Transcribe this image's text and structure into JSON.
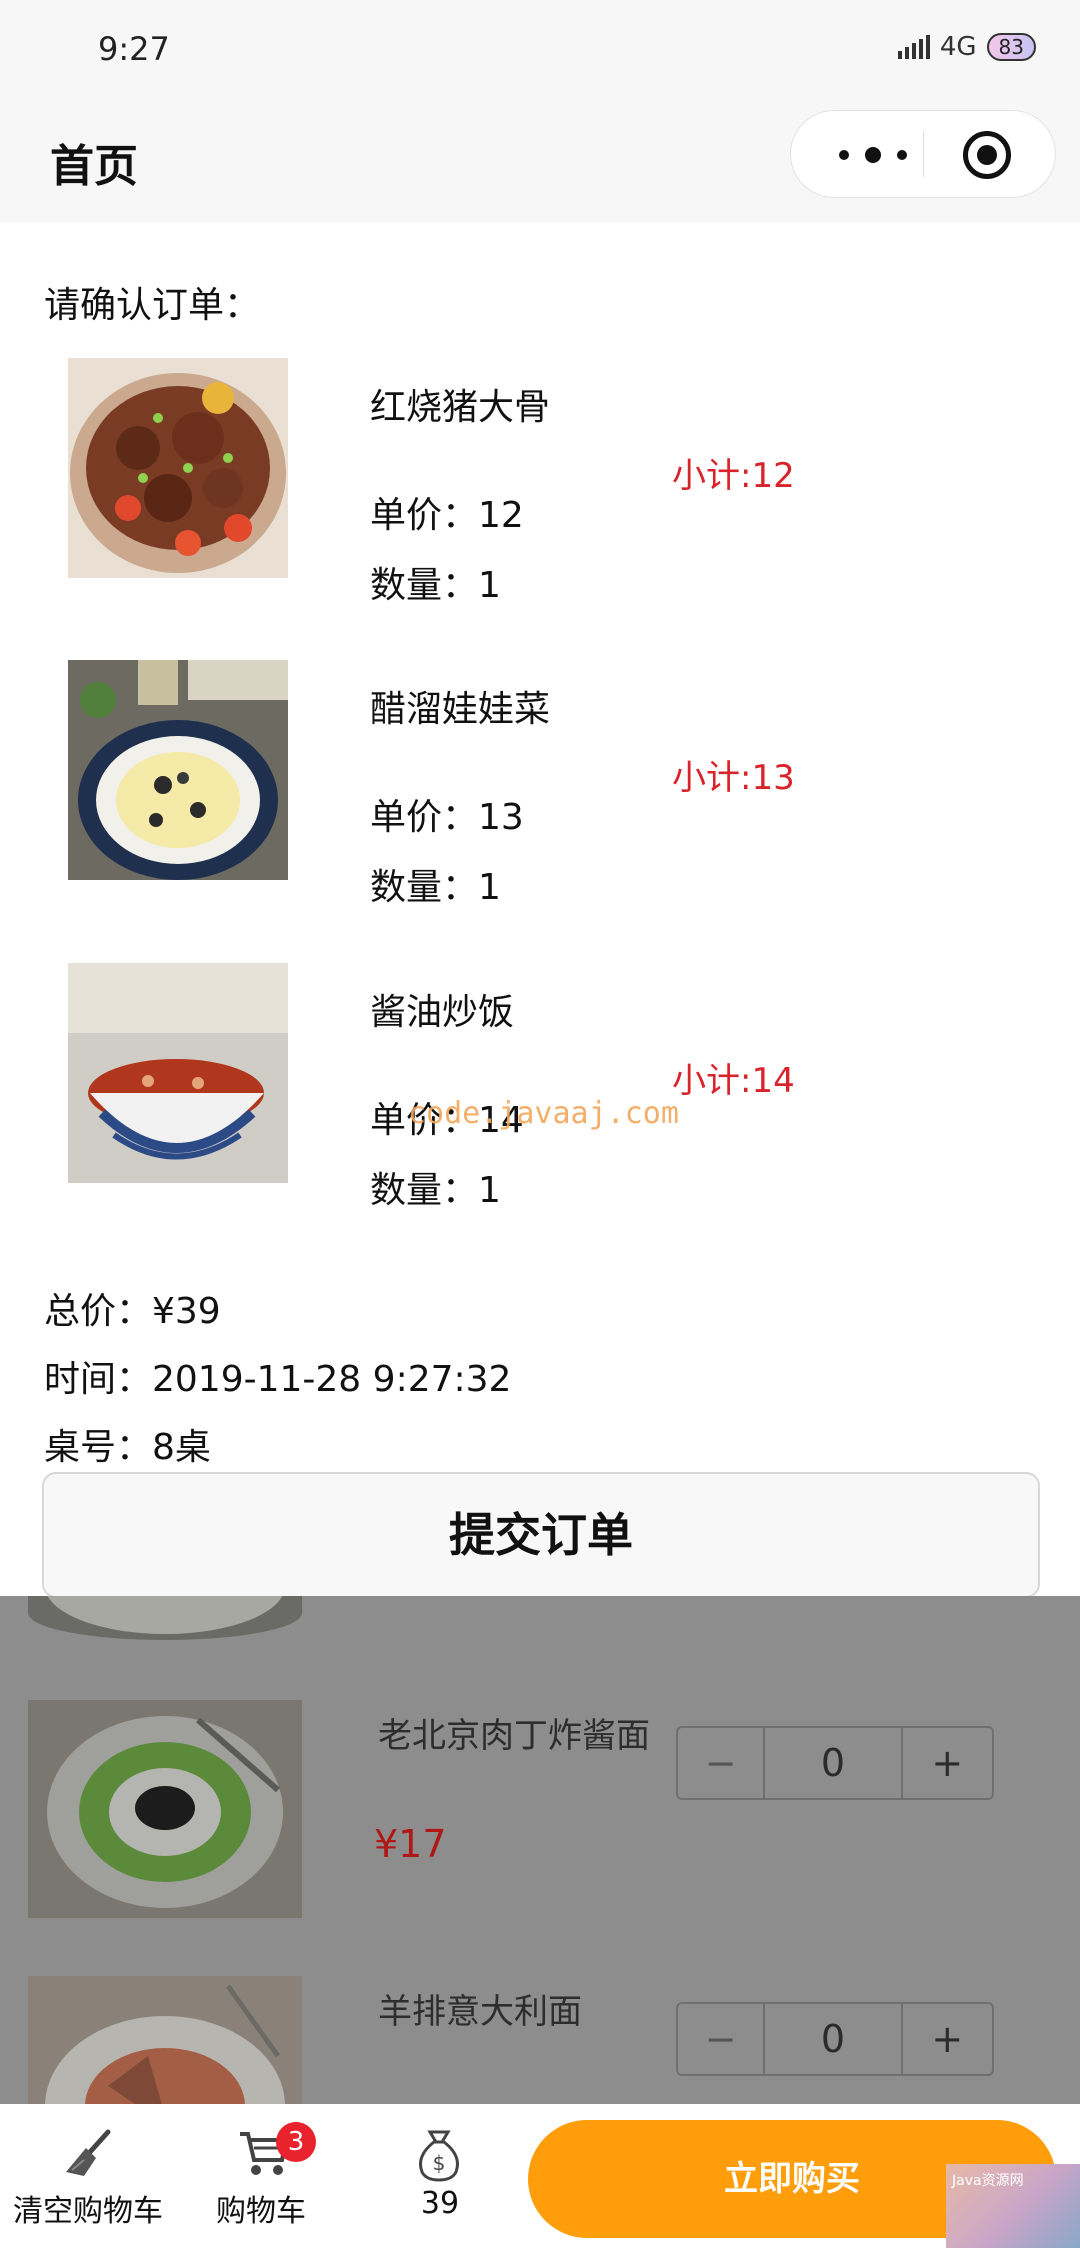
{
  "status": {
    "time": "9:27",
    "network": "4G",
    "battery": "83"
  },
  "nav": {
    "title": "首页"
  },
  "order": {
    "title": "请确认订单：",
    "items": [
      {
        "name": "红烧猪大骨",
        "price": "单价：12",
        "qty": "数量：1",
        "subtotal": "小计:12"
      },
      {
        "name": "醋溜娃娃菜",
        "price": "单价：13",
        "qty": "数量：1",
        "subtotal": "小计:13"
      },
      {
        "name": "酱油炒饭",
        "price": "单价：14",
        "qty": "数量：1",
        "subtotal": "小计:14"
      }
    ],
    "total": "总价：¥39",
    "time": "时间：2019-11-28 9:27:32",
    "table": "桌号：8桌",
    "submit_label": "提交订单"
  },
  "watermark": "code.javaaj.com",
  "menu": {
    "dishes": [
      {
        "name": "老北京肉丁炸酱面",
        "price": "¥17",
        "count": "0"
      },
      {
        "name": "羊排意大利面",
        "count": "0"
      }
    ],
    "minus": "−",
    "plus": "+"
  },
  "tabbar": {
    "clear_label": "清空购物车",
    "cart_label": "购物车",
    "cart_badge": "3",
    "total_label": "39",
    "buy_label": "立即购买",
    "ad_text": "Java资源网"
  },
  "icons": [
    "broom-icon",
    "cart-icon",
    "money-bag-icon",
    "more-dots-icon",
    "target-icon"
  ]
}
